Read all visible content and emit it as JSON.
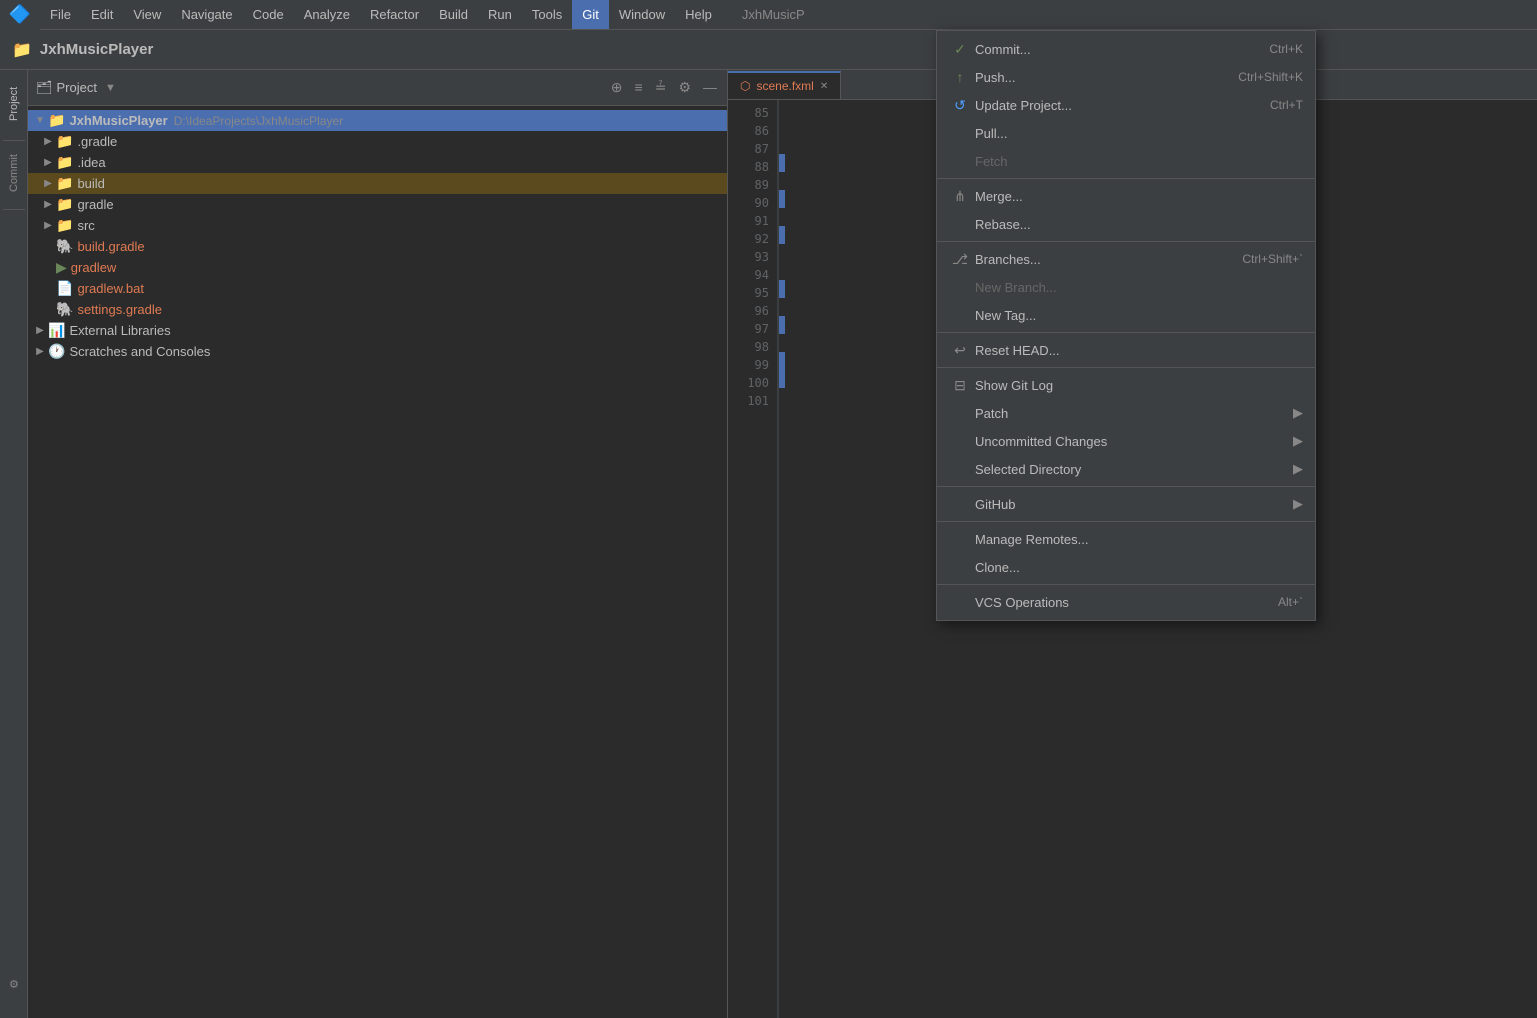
{
  "titlebar": {
    "project_name": "JxhMusicPlayer",
    "menu_items": [
      "File",
      "Edit",
      "View",
      "Navigate",
      "Code",
      "Analyze",
      "Refactor",
      "Build",
      "Run",
      "Tools",
      "Git",
      "Window",
      "Help"
    ]
  },
  "project_panel": {
    "title": "Project",
    "tree": [
      {
        "id": "root",
        "label": "JxhMusicPlayer",
        "path": "D:\\IdeaProjects\\JxhMusicPlayer",
        "indent": 0,
        "type": "root",
        "expanded": true
      },
      {
        "id": "gradle_dir",
        "label": ".gradle",
        "indent": 1,
        "type": "folder_orange",
        "expanded": false
      },
      {
        "id": "idea_dir",
        "label": ".idea",
        "indent": 1,
        "type": "folder",
        "expanded": false
      },
      {
        "id": "build_dir",
        "label": "build",
        "indent": 1,
        "type": "folder_orange",
        "expanded": false,
        "selected": true
      },
      {
        "id": "gradle",
        "label": "gradle",
        "indent": 1,
        "type": "folder",
        "expanded": false
      },
      {
        "id": "src",
        "label": "src",
        "indent": 1,
        "type": "folder",
        "expanded": false
      },
      {
        "id": "build_gradle",
        "label": "build.gradle",
        "indent": 1,
        "type": "file_gradle",
        "modified": true
      },
      {
        "id": "gradlew",
        "label": "gradlew",
        "indent": 1,
        "type": "file_text",
        "modified": true
      },
      {
        "id": "gradlew_bat",
        "label": "gradlew.bat",
        "indent": 1,
        "type": "file_bat",
        "modified": true
      },
      {
        "id": "settings_gradle",
        "label": "settings.gradle",
        "indent": 1,
        "type": "file_gradle",
        "modified": true
      },
      {
        "id": "external_libs",
        "label": "External Libraries",
        "indent": 0,
        "type": "external_libs",
        "expanded": false
      },
      {
        "id": "scratches",
        "label": "Scratches and Consoles",
        "indent": 0,
        "type": "scratches",
        "expanded": false
      }
    ]
  },
  "editor": {
    "tabs": [
      {
        "id": "scene_fxml",
        "label": "scene.fxml",
        "active": true,
        "type": "fxml"
      }
    ],
    "line_numbers": [
      85,
      86,
      87,
      88,
      89,
      90,
      91,
      92,
      93,
      94,
      95,
      96,
      97,
      98,
      99,
      100,
      101
    ]
  },
  "git_menu": {
    "items": [
      {
        "id": "commit",
        "label": "Commit...",
        "shortcut": "Ctrl+K",
        "icon": "check",
        "icon_color": "green",
        "disabled": false,
        "has_arrow": false
      },
      {
        "id": "push",
        "label": "Push...",
        "shortcut": "Ctrl+Shift+K",
        "icon": "arrow_up",
        "icon_color": "green",
        "disabled": false,
        "has_arrow": false
      },
      {
        "id": "update_project",
        "label": "Update Project...",
        "shortcut": "Ctrl+T",
        "icon": "arrow_refresh",
        "icon_color": "blue",
        "disabled": false,
        "has_arrow": false
      },
      {
        "id": "pull",
        "label": "Pull...",
        "shortcut": "",
        "icon": "",
        "disabled": false,
        "has_arrow": false
      },
      {
        "id": "fetch",
        "label": "Fetch",
        "shortcut": "",
        "icon": "",
        "disabled": true,
        "has_arrow": false
      },
      {
        "id": "sep1",
        "type": "separator"
      },
      {
        "id": "merge",
        "label": "Merge...",
        "shortcut": "",
        "icon": "merge",
        "icon_color": "gray",
        "disabled": false,
        "has_arrow": false
      },
      {
        "id": "rebase",
        "label": "Rebase...",
        "shortcut": "",
        "icon": "",
        "disabled": false,
        "has_arrow": false
      },
      {
        "id": "sep2",
        "type": "separator"
      },
      {
        "id": "branches",
        "label": "Branches...",
        "shortcut": "Ctrl+Shift+`",
        "icon": "branch",
        "icon_color": "gray",
        "disabled": false,
        "has_arrow": false
      },
      {
        "id": "new_branch",
        "label": "New Branch...",
        "shortcut": "",
        "icon": "",
        "disabled": true,
        "has_arrow": false
      },
      {
        "id": "new_tag",
        "label": "New Tag...",
        "shortcut": "",
        "icon": "",
        "disabled": false,
        "has_arrow": false
      },
      {
        "id": "sep3",
        "type": "separator"
      },
      {
        "id": "reset_head",
        "label": "Reset HEAD...",
        "shortcut": "",
        "icon": "reset",
        "icon_color": "gray",
        "disabled": false,
        "has_arrow": false
      },
      {
        "id": "sep4",
        "type": "separator"
      },
      {
        "id": "show_git_log",
        "label": "Show Git Log",
        "shortcut": "",
        "icon": "log",
        "icon_color": "gray",
        "disabled": false,
        "has_arrow": false
      },
      {
        "id": "patch",
        "label": "Patch",
        "shortcut": "",
        "icon": "",
        "disabled": false,
        "has_arrow": true
      },
      {
        "id": "uncommitted_changes",
        "label": "Uncommitted Changes",
        "shortcut": "",
        "icon": "",
        "disabled": false,
        "has_arrow": true
      },
      {
        "id": "selected_directory",
        "label": "Selected Directory",
        "shortcut": "",
        "icon": "",
        "disabled": false,
        "has_arrow": true
      },
      {
        "id": "sep5",
        "type": "separator"
      },
      {
        "id": "github",
        "label": "GitHub",
        "shortcut": "",
        "icon": "",
        "disabled": false,
        "has_arrow": true
      },
      {
        "id": "sep6",
        "type": "separator"
      },
      {
        "id": "manage_remotes",
        "label": "Manage Remotes...",
        "shortcut": "",
        "icon": "",
        "disabled": false,
        "has_arrow": false
      },
      {
        "id": "clone",
        "label": "Clone...",
        "shortcut": "",
        "icon": "",
        "disabled": false,
        "has_arrow": false
      },
      {
        "id": "sep7",
        "type": "separator"
      },
      {
        "id": "vcs_operations",
        "label": "VCS Operations",
        "shortcut": "Alt+`",
        "icon": "",
        "disabled": false,
        "has_arrow": false
      }
    ]
  },
  "sidebar": {
    "items": [
      "Project",
      "Commit"
    ]
  },
  "icons": {
    "logo": "🔷",
    "folder": "📁",
    "expand": "▶",
    "collapse": "▼",
    "check_green": "✓",
    "arrow_up": "↑",
    "arrow_refresh": "↺",
    "merge": "⋔",
    "branch": "⎇",
    "reset": "↩",
    "log": "⊟",
    "arrow_right": "▶"
  }
}
